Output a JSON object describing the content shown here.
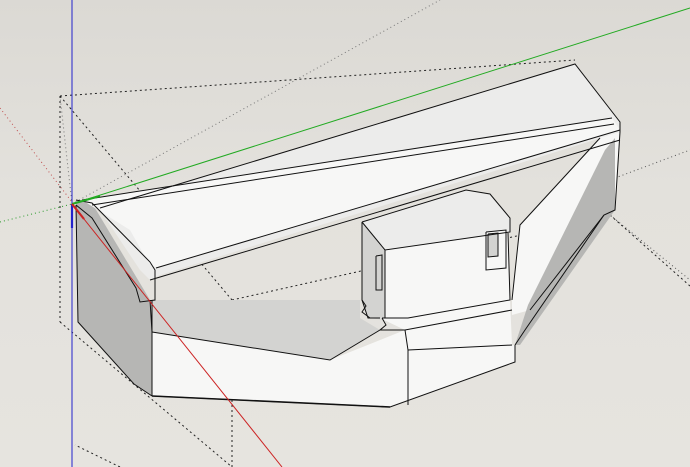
{
  "app": {
    "type": "3d-modeling-viewport"
  },
  "scene": {
    "model": "extruded-solid-with-box",
    "axes": {
      "red_color": "#cc2222",
      "green_color": "#22aa22",
      "blue_color": "#2222cc"
    },
    "background_color": "#e3e1dc",
    "face_colors": {
      "top": "#ececeb",
      "light": "#f7f7f6",
      "mid": "#d3d3d1",
      "dark": "#b6b6b4"
    }
  }
}
